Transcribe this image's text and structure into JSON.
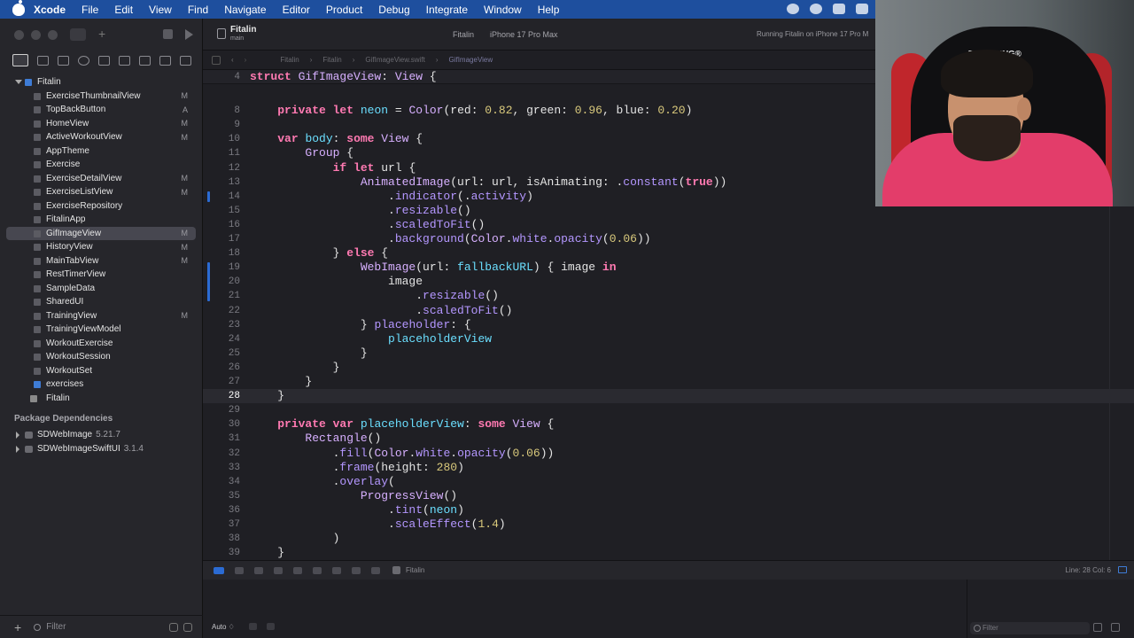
{
  "menubar": {
    "app_name": "Xcode",
    "items": [
      "File",
      "Edit",
      "View",
      "Find",
      "Navigate",
      "Editor",
      "Product",
      "Debug",
      "Integrate",
      "Window",
      "Help"
    ]
  },
  "toolbar": {
    "project": "Fitalin",
    "branch": "main",
    "scheme": "Fitalin",
    "destination": "iPhone 17 Pro Max",
    "status": "Running Fitalin on iPhone 17 Pro M"
  },
  "breadcrumb": [
    "Fitalin",
    "Fitalin",
    "GifImageView.swift",
    "GifImageView"
  ],
  "navigator": {
    "root": "Fitalin",
    "files": [
      {
        "name": "ExerciseThumbnailView",
        "badge": "M"
      },
      {
        "name": "TopBackButton",
        "badge": "A"
      },
      {
        "name": "HomeView",
        "badge": "M"
      },
      {
        "name": "ActiveWorkoutView",
        "badge": "M"
      },
      {
        "name": "AppTheme",
        "badge": ""
      },
      {
        "name": "Exercise",
        "badge": ""
      },
      {
        "name": "ExerciseDetailView",
        "badge": "M"
      },
      {
        "name": "ExerciseListView",
        "badge": "M"
      },
      {
        "name": "ExerciseRepository",
        "badge": ""
      },
      {
        "name": "FitalinApp",
        "badge": ""
      },
      {
        "name": "GifImageView",
        "badge": "M",
        "selected": true
      },
      {
        "name": "HistoryView",
        "badge": "M"
      },
      {
        "name": "MainTabView",
        "badge": "M"
      },
      {
        "name": "RestTimerView",
        "badge": ""
      },
      {
        "name": "SampleData",
        "badge": ""
      },
      {
        "name": "SharedUI",
        "badge": ""
      },
      {
        "name": "TrainingView",
        "badge": "M"
      },
      {
        "name": "TrainingViewModel",
        "badge": ""
      },
      {
        "name": "WorkoutExercise",
        "badge": ""
      },
      {
        "name": "WorkoutSession",
        "badge": ""
      },
      {
        "name": "WorkoutSet",
        "badge": ""
      },
      {
        "name": "exercises",
        "badge": "",
        "kind": "folder"
      },
      {
        "name": "Fitalin",
        "badge": "",
        "kind": "app"
      }
    ],
    "package_header": "Package Dependencies",
    "packages": [
      {
        "name": "SDWebImage",
        "version": "5.21.7"
      },
      {
        "name": "SDWebImageSwiftUI",
        "version": "3.1.4"
      }
    ],
    "filter_placeholder": "Filter"
  },
  "code": {
    "sticky_line": {
      "n": "4",
      "segs": [
        [
          "kw",
          "struct "
        ],
        [
          "ty",
          "GifImageView"
        ],
        [
          "",
          ": "
        ],
        [
          "ty",
          "View"
        ],
        [
          "",
          " {"
        ]
      ]
    },
    "lines": [
      {
        "n": "7",
        "segs": []
      },
      {
        "n": "8",
        "segs": [
          [
            "",
            "    "
          ],
          [
            "kw",
            "private let "
          ],
          [
            "id",
            "neon"
          ],
          [
            "",
            " = "
          ],
          [
            "ty",
            "Color"
          ],
          [
            "",
            "(red: "
          ],
          [
            "num",
            "0.82"
          ],
          [
            "",
            ", green: "
          ],
          [
            "num",
            "0.96"
          ],
          [
            "",
            ", blue: "
          ],
          [
            "num",
            "0.20"
          ],
          [
            "",
            ")"
          ]
        ]
      },
      {
        "n": "9",
        "segs": []
      },
      {
        "n": "10",
        "segs": [
          [
            "",
            "    "
          ],
          [
            "kw",
            "var "
          ],
          [
            "id",
            "body"
          ],
          [
            "",
            ": "
          ],
          [
            "kw",
            "some "
          ],
          [
            "ty",
            "View"
          ],
          [
            "",
            " {"
          ]
        ]
      },
      {
        "n": "11",
        "segs": [
          [
            "",
            "        "
          ],
          [
            "ty",
            "Group"
          ],
          [
            "",
            " {"
          ]
        ]
      },
      {
        "n": "12",
        "segs": [
          [
            "",
            "            "
          ],
          [
            "kw",
            "if let "
          ],
          [
            "",
            "url {"
          ]
        ]
      },
      {
        "n": "13",
        "segs": [
          [
            "",
            "                "
          ],
          [
            "ty",
            "AnimatedImage"
          ],
          [
            "",
            "(url: url, isAnimating: ."
          ],
          [
            "mem",
            "constant"
          ],
          [
            "",
            "("
          ],
          [
            "kw",
            "true"
          ],
          [
            "",
            "))"
          ]
        ]
      },
      {
        "n": "14",
        "segs": [
          [
            "",
            "                    ."
          ],
          [
            "mem",
            "indicator"
          ],
          [
            "",
            "(."
          ],
          [
            "mem",
            "activity"
          ],
          [
            "",
            ")"
          ]
        ]
      },
      {
        "n": "15",
        "segs": [
          [
            "",
            "                    ."
          ],
          [
            "mem",
            "resizable"
          ],
          [
            "",
            "()"
          ]
        ]
      },
      {
        "n": "16",
        "segs": [
          [
            "",
            "                    ."
          ],
          [
            "mem",
            "scaledToFit"
          ],
          [
            "",
            "()"
          ]
        ]
      },
      {
        "n": "17",
        "segs": [
          [
            "",
            "                    ."
          ],
          [
            "mem",
            "background"
          ],
          [
            "",
            "("
          ],
          [
            "ty",
            "Color"
          ],
          [
            "",
            "."
          ],
          [
            "mem",
            "white"
          ],
          [
            "",
            "."
          ],
          [
            "mem",
            "opacity"
          ],
          [
            "",
            "("
          ],
          [
            "num",
            "0.06"
          ],
          [
            "",
            "))"
          ]
        ]
      },
      {
        "n": "18",
        "segs": [
          [
            "",
            "            } "
          ],
          [
            "kw",
            "else"
          ],
          [
            "",
            " {"
          ]
        ]
      },
      {
        "n": "19",
        "segs": [
          [
            "",
            "                "
          ],
          [
            "ty",
            "WebImage"
          ],
          [
            "",
            "(url: "
          ],
          [
            "id",
            "fallbackURL"
          ],
          [
            "",
            ") { image "
          ],
          [
            "kw",
            "in"
          ]
        ]
      },
      {
        "n": "20",
        "segs": [
          [
            "",
            "                    image"
          ]
        ]
      },
      {
        "n": "21",
        "segs": [
          [
            "",
            "                        ."
          ],
          [
            "mem",
            "resizable"
          ],
          [
            "",
            "()"
          ]
        ]
      },
      {
        "n": "22",
        "segs": [
          [
            "",
            "                        ."
          ],
          [
            "mem",
            "scaledToFit"
          ],
          [
            "",
            "()"
          ]
        ]
      },
      {
        "n": "23",
        "segs": [
          [
            "",
            "                } "
          ],
          [
            "mem",
            "placeholder"
          ],
          [
            "",
            ": {"
          ]
        ]
      },
      {
        "n": "24",
        "segs": [
          [
            "",
            "                    "
          ],
          [
            "id",
            "placeholderView"
          ]
        ]
      },
      {
        "n": "25",
        "segs": [
          [
            "",
            "                }"
          ]
        ]
      },
      {
        "n": "26",
        "segs": [
          [
            "",
            "            }"
          ]
        ]
      },
      {
        "n": "27",
        "segs": [
          [
            "",
            "        }"
          ]
        ]
      },
      {
        "n": "28",
        "segs": [
          [
            "",
            "    }"
          ]
        ],
        "current": true
      },
      {
        "n": "29",
        "segs": []
      },
      {
        "n": "30",
        "segs": [
          [
            "",
            "    "
          ],
          [
            "kw",
            "private var "
          ],
          [
            "id",
            "placeholderView"
          ],
          [
            "",
            ": "
          ],
          [
            "kw",
            "some "
          ],
          [
            "ty",
            "View"
          ],
          [
            "",
            " {"
          ]
        ]
      },
      {
        "n": "31",
        "segs": [
          [
            "",
            "        "
          ],
          [
            "ty",
            "Rectangle"
          ],
          [
            "",
            "()"
          ]
        ]
      },
      {
        "n": "32",
        "segs": [
          [
            "",
            "            ."
          ],
          [
            "mem",
            "fill"
          ],
          [
            "",
            "("
          ],
          [
            "ty",
            "Color"
          ],
          [
            "",
            "."
          ],
          [
            "mem",
            "white"
          ],
          [
            "",
            "."
          ],
          [
            "mem",
            "opacity"
          ],
          [
            "",
            "("
          ],
          [
            "num",
            "0.06"
          ],
          [
            "",
            "))"
          ]
        ]
      },
      {
        "n": "33",
        "segs": [
          [
            "",
            "            ."
          ],
          [
            "mem",
            "frame"
          ],
          [
            "",
            "(height: "
          ],
          [
            "num",
            "280"
          ],
          [
            "",
            ")"
          ]
        ]
      },
      {
        "n": "34",
        "segs": [
          [
            "",
            "            ."
          ],
          [
            "mem",
            "overlay"
          ],
          [
            "",
            "("
          ]
        ]
      },
      {
        "n": "35",
        "segs": [
          [
            "",
            "                "
          ],
          [
            "ty",
            "ProgressView"
          ],
          [
            "",
            "()"
          ]
        ]
      },
      {
        "n": "36",
        "segs": [
          [
            "",
            "                    ."
          ],
          [
            "mem",
            "tint"
          ],
          [
            "",
            "("
          ],
          [
            "id",
            "neon"
          ],
          [
            "",
            ")"
          ]
        ]
      },
      {
        "n": "37",
        "segs": [
          [
            "",
            "                    ."
          ],
          [
            "mem",
            "scaleEffect"
          ],
          [
            "",
            "("
          ],
          [
            "num",
            "1.4"
          ],
          [
            "",
            ")"
          ]
        ]
      },
      {
        "n": "38",
        "segs": [
          [
            "",
            "            )"
          ]
        ]
      },
      {
        "n": "39",
        "segs": [
          [
            "",
            "    }"
          ]
        ]
      }
    ]
  },
  "debugbar": {
    "target": "Fitalin",
    "position": "Line: 28  Col: 6"
  },
  "console": {
    "mode": "Auto ♢",
    "filter_placeholder": "Filter"
  },
  "webcam": {
    "chair_brand": "DXRACING®"
  }
}
